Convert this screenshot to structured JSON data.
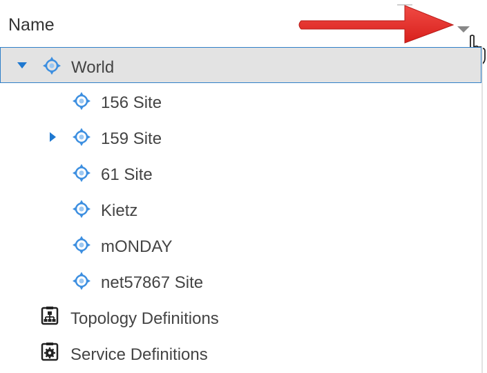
{
  "header": {
    "column_label": "Name"
  },
  "tree": {
    "root": {
      "label": "World",
      "expanded": true,
      "selected": true
    },
    "sites": [
      {
        "label": "156 Site",
        "has_children": false
      },
      {
        "label": "159 Site",
        "has_children": true
      },
      {
        "label": "61 Site",
        "has_children": false
      },
      {
        "label": "Kietz",
        "has_children": false
      },
      {
        "label": "mONDAY",
        "has_children": false
      },
      {
        "label": "net57867 Site",
        "has_children": false
      }
    ],
    "topology_definitions": "Topology Definitions",
    "service_definitions": "Service Definitions"
  },
  "colors": {
    "selection_border": "#2f7fc8",
    "selection_fill": "#e3e3e3",
    "expander": "#1e78d0",
    "site_icon": "#3d8fe0",
    "annotation_arrow": "#e8322f"
  },
  "icons": {
    "site": "crosshair-site-icon",
    "topology": "topology-definitions-icon",
    "service": "service-definitions-icon"
  }
}
